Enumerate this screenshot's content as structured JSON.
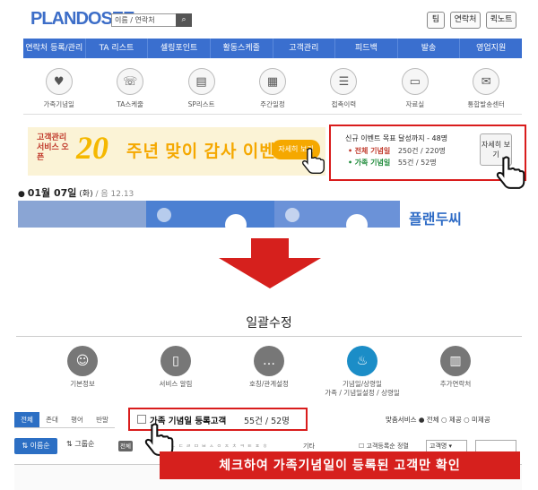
{
  "header": {
    "logo_text": "PLANDOSEE",
    "search_placeholder": "이름 / 연락처",
    "buttons": [
      "팀",
      "연락처",
      "퀵노트"
    ]
  },
  "nav": [
    "연락처 등록/관리",
    "TA 리스트",
    "셀링포인트",
    "활동스케줄",
    "고객관리",
    "피드백",
    "발송",
    "영업지원"
  ],
  "icon_row": [
    {
      "label": "가족기념일",
      "icon": "heart-icon"
    },
    {
      "label": "TA스케줄",
      "icon": "phone-icon"
    },
    {
      "label": "SP리스트",
      "icon": "document-icon"
    },
    {
      "label": "주간일정",
      "icon": "calendar-icon"
    },
    {
      "label": "접촉이력",
      "icon": "contact-history-icon"
    },
    {
      "label": "자료실",
      "icon": "folder-icon"
    },
    {
      "label": "통합발송센터",
      "icon": "mail-icon"
    }
  ],
  "banner": {
    "small_text": "고객관리 서비스 오픈",
    "number": "20",
    "title": "주년 맞이 감사 이벤트",
    "button": "자세히 보기"
  },
  "target_box": {
    "title": "신규 이벤트 목표 달성까지 - 48명",
    "line1_label": "전체 기념일",
    "line1_value": "250건 / 220명",
    "line2_label": "가족 기념일",
    "line2_value": "55건 / 52명",
    "detail_button": "자세히 보기"
  },
  "date": {
    "main": "01월 07일",
    "day": "(화)",
    "lunar": "/ 음 12.13"
  },
  "brand_tile": "플랜두씨",
  "modal": {
    "title": "일괄수정",
    "icons": [
      {
        "label": "기본정보",
        "icon": "person-icon"
      },
      {
        "label": "서비스 알림",
        "icon": "bell-icon"
      },
      {
        "label": "호칭/관계설정",
        "icon": "chat-icon"
      },
      {
        "label": "기념일/상령일",
        "label2": "가족 / 기념일설정 / 상령일",
        "icon": "cake-icon"
      },
      {
        "label": "추가연락처",
        "icon": "address-book-icon"
      }
    ],
    "tabs": [
      "전체",
      "존대",
      "평어",
      "반말"
    ],
    "filter_label": "가족 기념일 등록고객",
    "filter_count": "55건 / 52명",
    "service_label": "맞춤서비스 ● 전체  ○ 제공  ○ 미제공",
    "sort_button": "이름순",
    "group_sort": "그룹순",
    "all_badge": "전체",
    "letters": "ㄱㄴㄷㄹㅁㅂㅅㅇㅈㅊㅋㅌㅍㅎ",
    "etc": "기타",
    "register_check": "고객등록순 정렬",
    "select_value": "고객명 ▾"
  },
  "caption": "체크하여 가족기념일이 등록된 고객만 확인",
  "colors": {
    "accent": "#3a6fcf",
    "highlight": "#d91c1c",
    "banner_bg": "#fbf3d6"
  }
}
